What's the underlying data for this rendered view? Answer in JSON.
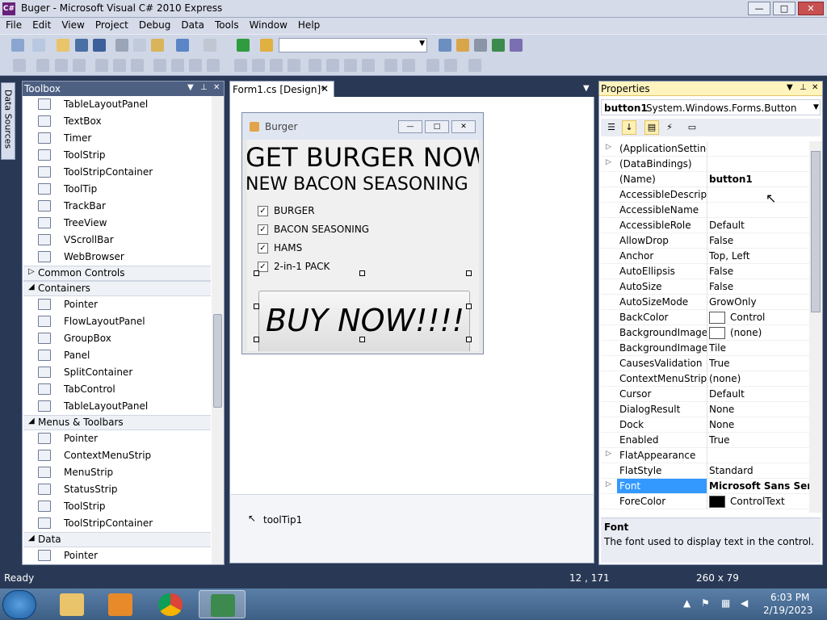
{
  "window": {
    "title": "Buger - Microsoft Visual C# 2010 Express",
    "icon_label": "C#",
    "min": "—",
    "max": "□",
    "close": "✕"
  },
  "menu": [
    "File",
    "Edit",
    "View",
    "Project",
    "Debug",
    "Data",
    "Tools",
    "Window",
    "Help"
  ],
  "toolbar": {
    "config_value": ""
  },
  "data_sources_tab": "Data Sources",
  "toolbox": {
    "title": "Toolbox",
    "rows": [
      {
        "kind": "item",
        "label": "TableLayoutPanel"
      },
      {
        "kind": "item",
        "label": "TextBox"
      },
      {
        "kind": "item",
        "label": "Timer"
      },
      {
        "kind": "item",
        "label": "ToolStrip"
      },
      {
        "kind": "item",
        "label": "ToolStripContainer"
      },
      {
        "kind": "item",
        "label": "ToolTip"
      },
      {
        "kind": "item",
        "label": "TrackBar"
      },
      {
        "kind": "item",
        "label": "TreeView"
      },
      {
        "kind": "item",
        "label": "VScrollBar"
      },
      {
        "kind": "item",
        "label": "WebBrowser"
      },
      {
        "kind": "group",
        "label": "Common Controls",
        "expanded": false
      },
      {
        "kind": "group",
        "label": "Containers",
        "expanded": true
      },
      {
        "kind": "item",
        "label": "Pointer"
      },
      {
        "kind": "item",
        "label": "FlowLayoutPanel"
      },
      {
        "kind": "item",
        "label": "GroupBox"
      },
      {
        "kind": "item",
        "label": "Panel"
      },
      {
        "kind": "item",
        "label": "SplitContainer"
      },
      {
        "kind": "item",
        "label": "TabControl"
      },
      {
        "kind": "item",
        "label": "TableLayoutPanel"
      },
      {
        "kind": "group",
        "label": "Menus & Toolbars",
        "expanded": true
      },
      {
        "kind": "item",
        "label": "Pointer"
      },
      {
        "kind": "item",
        "label": "ContextMenuStrip"
      },
      {
        "kind": "item",
        "label": "MenuStrip"
      },
      {
        "kind": "item",
        "label": "StatusStrip"
      },
      {
        "kind": "item",
        "label": "ToolStrip"
      },
      {
        "kind": "item",
        "label": "ToolStripContainer"
      },
      {
        "kind": "group",
        "label": "Data",
        "expanded": true
      },
      {
        "kind": "item",
        "label": "Pointer"
      }
    ]
  },
  "document": {
    "tab_label": "Form1.cs [Design]*",
    "tab_close": "✕"
  },
  "form": {
    "caption": "Burger",
    "headline1": "GET BURGER NOW",
    "headline2": "NEW BACON SEASONING",
    "checkboxes": [
      {
        "label": "BURGER",
        "checked": true
      },
      {
        "label": "BACON SEASONING",
        "checked": true
      },
      {
        "label": "HAMS",
        "checked": true
      },
      {
        "label": "2-in-1 PACK",
        "checked": true
      }
    ],
    "button_text": "BUY NOW!!!!"
  },
  "tray": {
    "component": "toolTip1"
  },
  "properties": {
    "title": "Properties",
    "object_name": "button1",
    "object_type": "System.Windows.Forms.Button",
    "rows": [
      {
        "name": "(ApplicationSettings",
        "value": "",
        "expandable": true
      },
      {
        "name": "(DataBindings)",
        "value": "",
        "expandable": true
      },
      {
        "name": "(Name)",
        "value": "button1",
        "bold": true
      },
      {
        "name": "AccessibleDescriptic",
        "value": ""
      },
      {
        "name": "AccessibleName",
        "value": ""
      },
      {
        "name": "AccessibleRole",
        "value": "Default"
      },
      {
        "name": "AllowDrop",
        "value": "False"
      },
      {
        "name": "Anchor",
        "value": "Top, Left"
      },
      {
        "name": "AutoEllipsis",
        "value": "False"
      },
      {
        "name": "AutoSize",
        "value": "False"
      },
      {
        "name": "AutoSizeMode",
        "value": "GrowOnly"
      },
      {
        "name": "BackColor",
        "value": "Control",
        "swatch": "#ffffff"
      },
      {
        "name": "BackgroundImage",
        "value": "(none)",
        "swatch": "#ffffff"
      },
      {
        "name": "BackgroundImageLa",
        "value": "Tile"
      },
      {
        "name": "CausesValidation",
        "value": "True"
      },
      {
        "name": "ContextMenuStrip",
        "value": "(none)"
      },
      {
        "name": "Cursor",
        "value": "Default"
      },
      {
        "name": "DialogResult",
        "value": "None"
      },
      {
        "name": "Dock",
        "value": "None"
      },
      {
        "name": "Enabled",
        "value": "True"
      },
      {
        "name": "FlatAppearance",
        "value": "",
        "expandable": true
      },
      {
        "name": "FlatStyle",
        "value": "Standard"
      },
      {
        "name": "Font",
        "value": "Microsoft Sans Ser",
        "expandable": true,
        "selected": true,
        "bold": true
      },
      {
        "name": "ForeColor",
        "value": "ControlText",
        "swatch": "#000000"
      }
    ],
    "description_title": "Font",
    "description_text": "The font used to display text in the control."
  },
  "status": {
    "ready": "Ready",
    "position": "12 , 171",
    "size": "260 x 79"
  },
  "taskbar": {
    "time": "6:03 PM",
    "date": "2/19/2023"
  },
  "colors": {
    "chrome_dark": "#293955",
    "selection": "#3399ff",
    "props_header": "#fff4bd"
  }
}
